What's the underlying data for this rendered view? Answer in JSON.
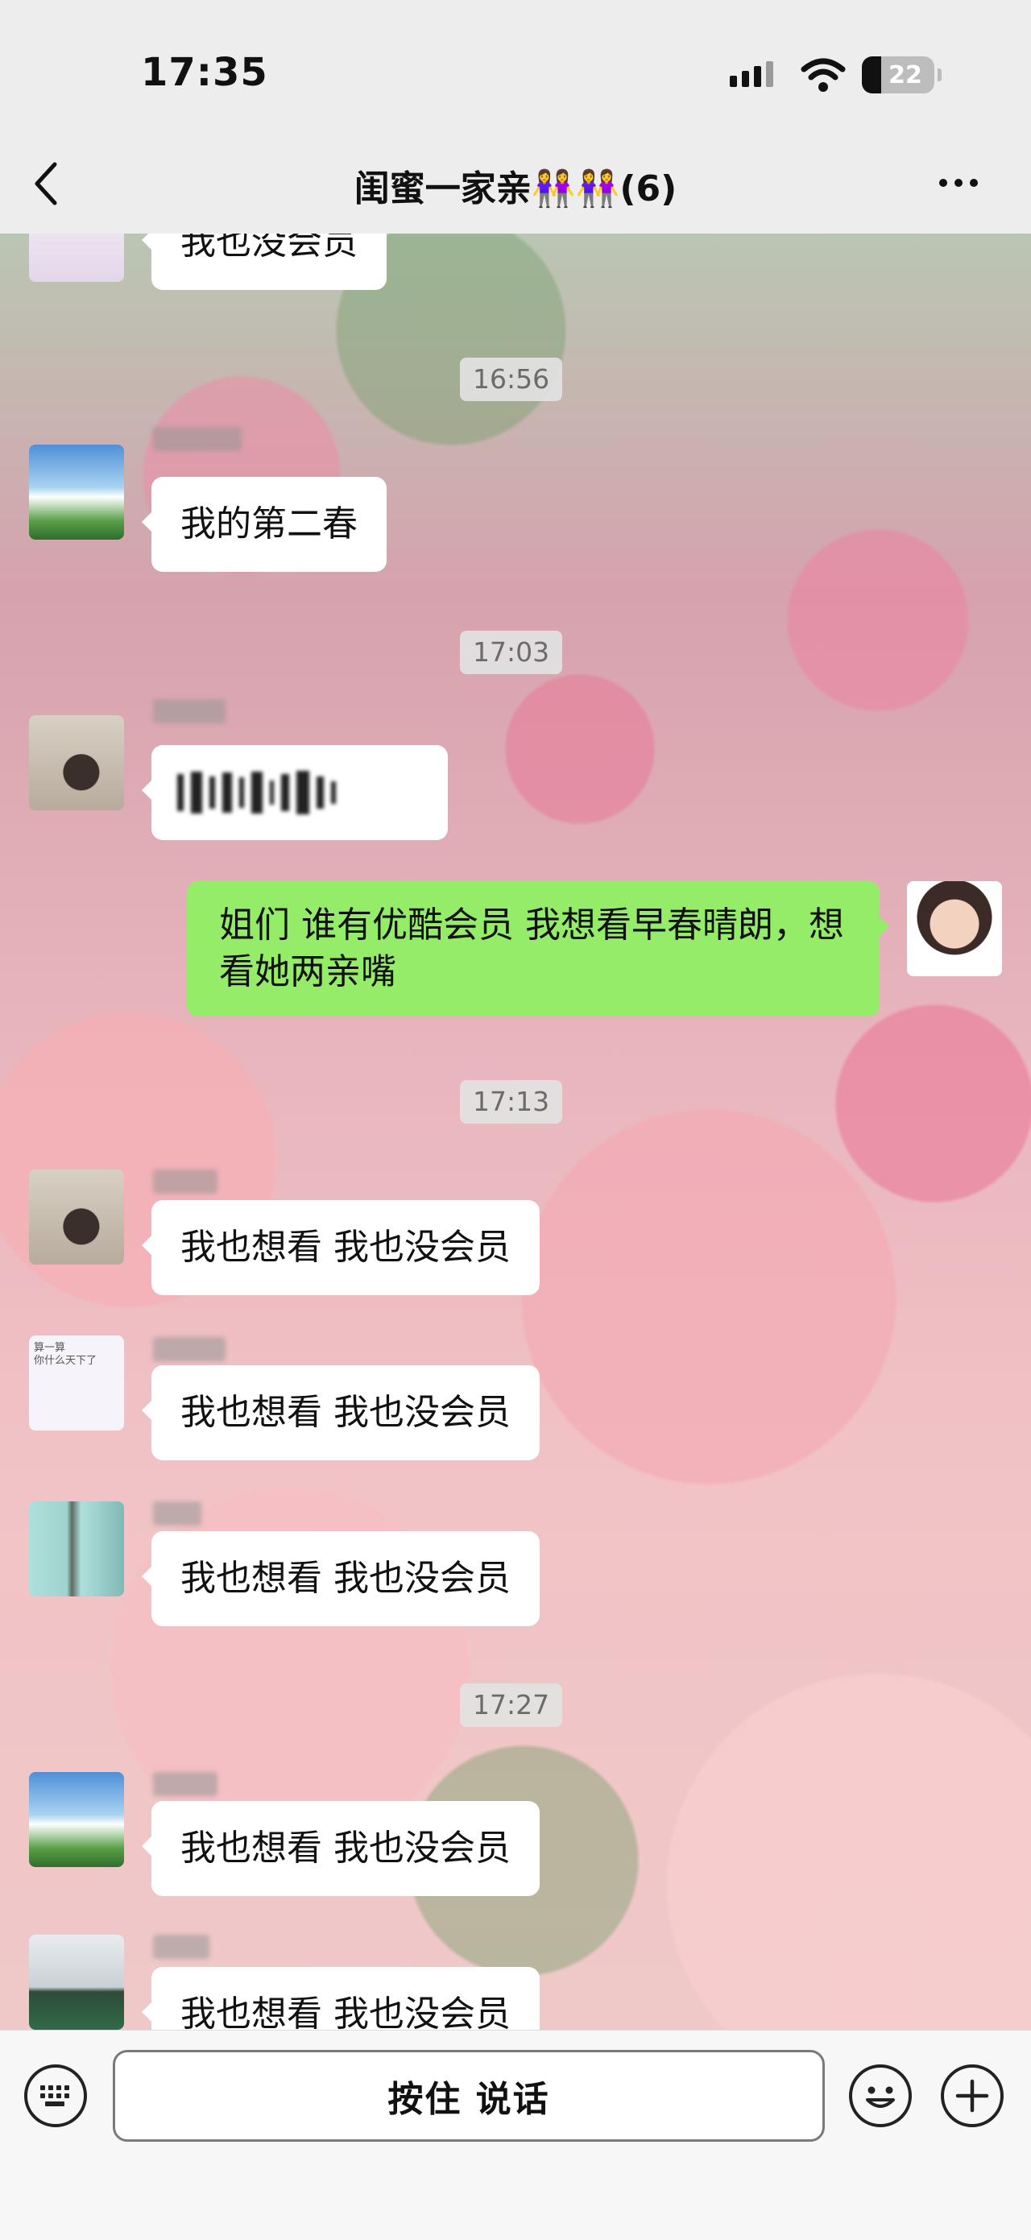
{
  "status_bar": {
    "time": "17:35",
    "battery": "22"
  },
  "header": {
    "title": "闺蜜一家亲👭👭(6)"
  },
  "timestamps": [
    "16:56",
    "17:03",
    "17:13",
    "17:27"
  ],
  "messages": [
    {
      "sender": "other",
      "text": "我也没会员"
    },
    {
      "sender": "other",
      "text": "我的第二春"
    },
    {
      "sender": "other",
      "text": ""
    },
    {
      "sender": "self",
      "text": "姐们 谁有优酷会员 我想看早春晴朗，想看她两亲嘴"
    },
    {
      "sender": "other",
      "text": "我也想看  我也没会员"
    },
    {
      "sender": "other",
      "text": "我也想看  我也没会员"
    },
    {
      "sender": "other",
      "text": "我也想看  我也没会员"
    },
    {
      "sender": "other",
      "text": "我也想看  我也没会员"
    },
    {
      "sender": "other",
      "text": "我也想看  我也没会员"
    }
  ],
  "avatar_texts": {
    "avatar_4": "算一算\n你什么天下了"
  },
  "input_bar": {
    "hold_to_talk": "按住 说话"
  },
  "icons": {
    "back": "chevron-left-icon",
    "more": "more-dots-icon",
    "keyboard": "keyboard-icon",
    "emoji": "emoji-icon",
    "add": "plus-icon"
  },
  "colors": {
    "self_bubble": "#95ec69",
    "other_bubble": "#ffffff",
    "header_bg": "#ededed"
  }
}
